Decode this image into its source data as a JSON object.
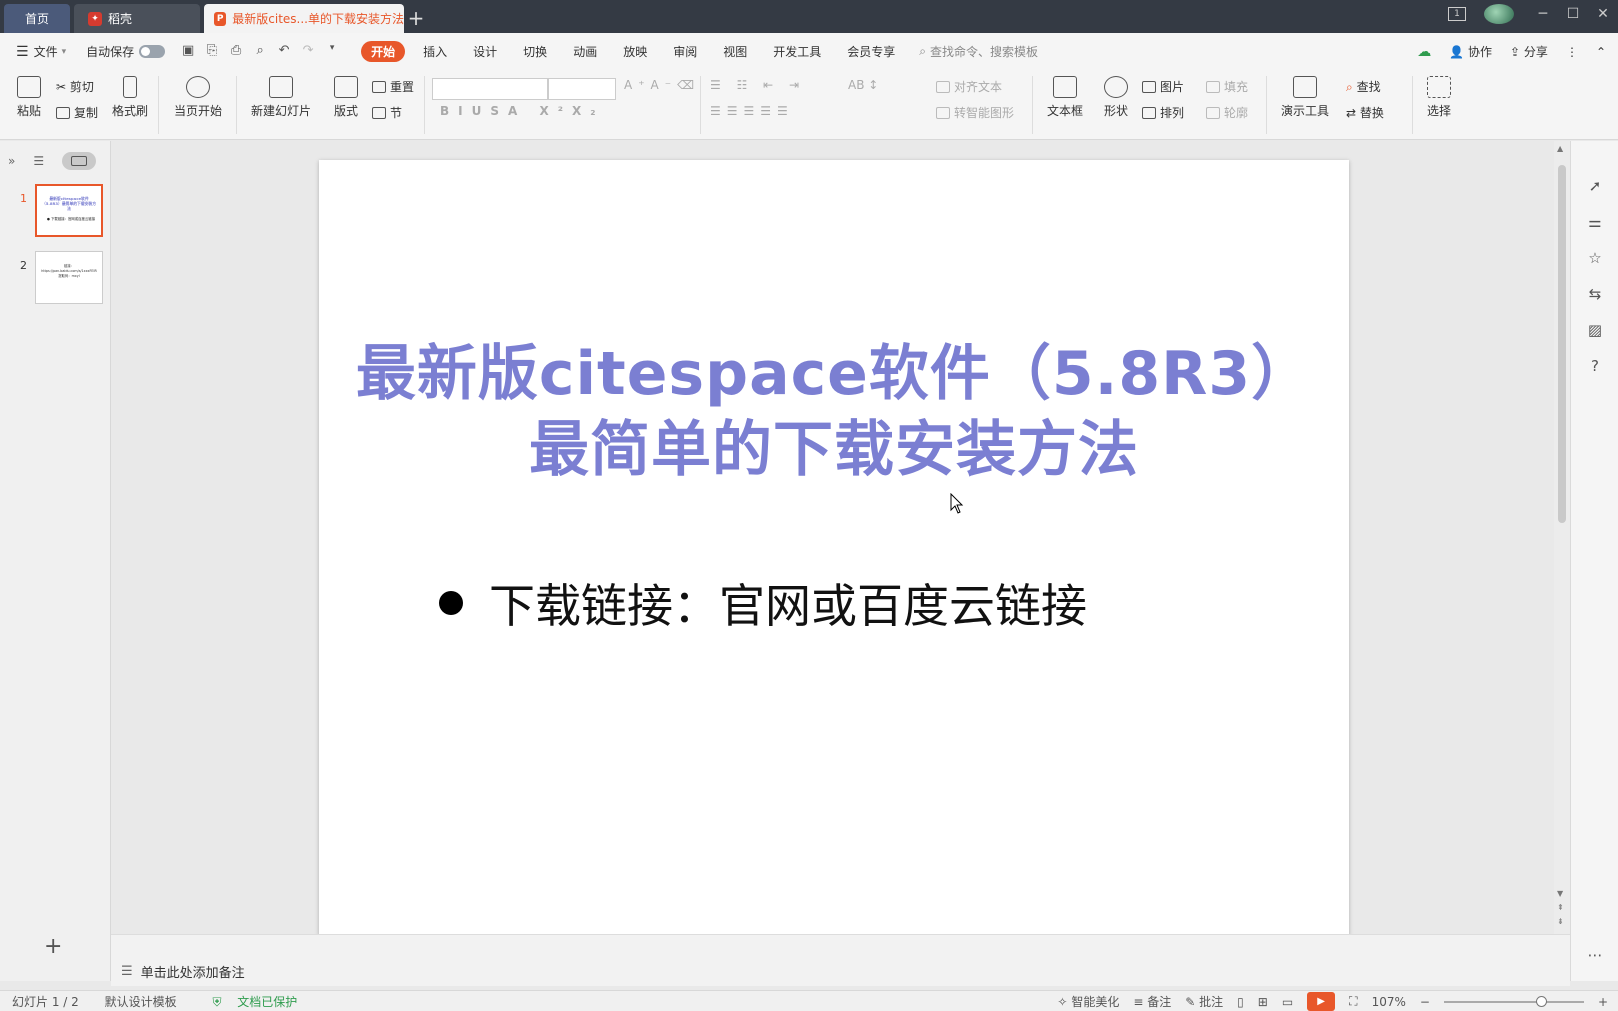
{
  "titlebar": {
    "tabs": [
      {
        "label": "首页"
      },
      {
        "label": "稻壳"
      },
      {
        "label": "最新版cites...单的下载安装方法"
      }
    ],
    "page_indicator": "1"
  },
  "menubar": {
    "file": "文件",
    "autosave": "自动保存",
    "tabs": [
      "开始",
      "插入",
      "设计",
      "切换",
      "动画",
      "放映",
      "审阅",
      "视图",
      "开发工具",
      "会员专享"
    ],
    "search_placeholder": "查找命令、搜索模板",
    "collab": "协作",
    "share": "分享"
  },
  "ribbon": {
    "paste": "粘贴",
    "cut": "剪切",
    "copy": "复制",
    "format_painter": "格式刷",
    "from_current": "当页开始",
    "new_slide": "新建幻灯片",
    "layout": "版式",
    "reset": "重置",
    "section": "节",
    "align_text": "对齐文本",
    "smart_shape": "转智能图形",
    "textbox": "文本框",
    "shape": "形状",
    "picture": "图片",
    "fill": "填充",
    "arrange": "排列",
    "outline": "轮廓",
    "presenter_tools": "演示工具",
    "find": "查找",
    "replace": "替换",
    "select": "选择"
  },
  "slides": {
    "thumb1": {
      "num": "1",
      "title": "最新版citespace软件（5.8R3）最简单的下载安装方法",
      "bullet": "● 下载链接：官网或百度云链接"
    },
    "thumb2": {
      "num": "2",
      "text": "链接：https://pan.baidu.com/s/1xxxFEIR 提取码：mxyl"
    }
  },
  "slide": {
    "title_line1": "最新版citespace软件（5.8R3）",
    "title_line2": "最简单的下载安装方法",
    "bullet": "下载链接：官网或百度云链接"
  },
  "notes": {
    "placeholder": "单击此处添加备注"
  },
  "statusbar": {
    "slide_count": "幻灯片 1 / 2",
    "template": "默认设计模板",
    "protected": "文档已保护",
    "beautify": "智能美化",
    "notes": "备注",
    "comments": "批注",
    "zoom": "107%",
    "zoom_level": 0.69
  },
  "colors": {
    "accent": "#e8572a",
    "title": "#7b7fd2"
  }
}
